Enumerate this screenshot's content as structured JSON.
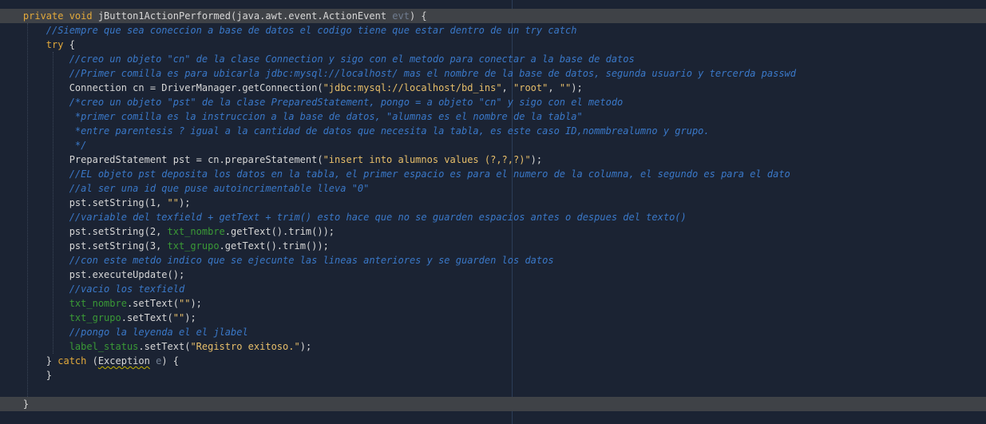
{
  "theme": {
    "background": "#1b2333",
    "keyword": "#e2a93b",
    "comment": "#3a78c8",
    "string": "#e8bf6a",
    "field": "#3a9a36",
    "parameter": "#6f7c90",
    "plain": "#d7d7d7",
    "current_line": "#3f4247"
  },
  "lines": [
    {
      "hl": true,
      "tokens": [
        {
          "t": "    "
        },
        {
          "t": "private void ",
          "c": "kw"
        },
        {
          "t": "jButton1ActionPerformed(java.awt.event.ActionEvent "
        },
        {
          "t": "evt",
          "c": "par"
        },
        {
          "t": ") {"
        }
      ]
    },
    {
      "tokens": [
        {
          "t": "        "
        },
        {
          "t": "//Siempre que sea coneccion a base de datos el codigo tiene que estar dentro de un try catch",
          "c": "cm"
        }
      ]
    },
    {
      "tokens": [
        {
          "t": "        "
        },
        {
          "t": "try",
          "c": "kw"
        },
        {
          "t": " {"
        }
      ]
    },
    {
      "tokens": [
        {
          "t": "            "
        },
        {
          "t": "//creo un objeto \"cn\" de la clase Connection y sigo con el metodo para conectar a la base de datos",
          "c": "cm"
        }
      ]
    },
    {
      "tokens": [
        {
          "t": "            "
        },
        {
          "t": "//Primer comilla es para ubicarla jdbc:mysql://localhost/ mas el nombre de la base de datos, segunda usuario y tercerda passwd",
          "c": "cm"
        }
      ]
    },
    {
      "tokens": [
        {
          "t": "            Connection cn = DriverManager.getConnection("
        },
        {
          "t": "\"jdbc:mysql://localhost/bd_ins\"",
          "c": "st"
        },
        {
          "t": ", "
        },
        {
          "t": "\"root\"",
          "c": "st"
        },
        {
          "t": ", "
        },
        {
          "t": "\"\"",
          "c": "st"
        },
        {
          "t": ");"
        }
      ]
    },
    {
      "tokens": [
        {
          "t": "            "
        },
        {
          "t": "/*creo un objeto \"pst\" de la clase PreparedStatement, pongo = a objeto \"cn\" y sigo con el metodo",
          "c": "cm"
        }
      ]
    },
    {
      "tokens": [
        {
          "t": "             "
        },
        {
          "t": "*primer comilla es la instruccion a la base de datos, \"alumnas es el nombre de la tabla\"",
          "c": "cm"
        }
      ]
    },
    {
      "tokens": [
        {
          "t": "             "
        },
        {
          "t": "*entre parentesis ? igual a la cantidad de datos que necesita la tabla, es este caso ID,nommbrealumno y grupo.",
          "c": "cm"
        }
      ]
    },
    {
      "tokens": [
        {
          "t": "             "
        },
        {
          "t": "*/",
          "c": "cm"
        }
      ]
    },
    {
      "tokens": [
        {
          "t": "            PreparedStatement pst = cn.prepareStatement("
        },
        {
          "t": "\"insert into alumnos values (?,?,?)\"",
          "c": "st"
        },
        {
          "t": ");"
        }
      ]
    },
    {
      "tokens": [
        {
          "t": "            "
        },
        {
          "t": "//EL objeto pst deposita los datos en la tabla, el primer espacio es para el numero de la columna, el segundo es para el dato",
          "c": "cm"
        }
      ]
    },
    {
      "tokens": [
        {
          "t": "            "
        },
        {
          "t": "//al ser una id que puse autoincrimentable lleva \"0\"",
          "c": "cm"
        }
      ]
    },
    {
      "tokens": [
        {
          "t": "            pst.setString(1, "
        },
        {
          "t": "\"\"",
          "c": "st"
        },
        {
          "t": ");"
        }
      ]
    },
    {
      "tokens": [
        {
          "t": "            "
        },
        {
          "t": "//variable del texfield + getText + trim() esto hace que no se guarden espacios antes o despues del texto()",
          "c": "cm"
        }
      ]
    },
    {
      "tokens": [
        {
          "t": "            pst.setString(2, "
        },
        {
          "t": "txt_nombre",
          "c": "fld"
        },
        {
          "t": ".getText().trim());"
        }
      ]
    },
    {
      "tokens": [
        {
          "t": "            pst.setString(3, "
        },
        {
          "t": "txt_grupo",
          "c": "fld"
        },
        {
          "t": ".getText().trim());"
        }
      ]
    },
    {
      "tokens": [
        {
          "t": "            "
        },
        {
          "t": "//con este metdo indico que se ejecunte las lineas anteriores y se guarden los datos",
          "c": "cm"
        }
      ]
    },
    {
      "tokens": [
        {
          "t": "            pst.executeUpdate();"
        }
      ]
    },
    {
      "tokens": [
        {
          "t": "            "
        },
        {
          "t": "//vacio los texfield",
          "c": "cm"
        }
      ]
    },
    {
      "tokens": [
        {
          "t": "            "
        },
        {
          "t": "txt_nombre",
          "c": "fld"
        },
        {
          "t": ".setText("
        },
        {
          "t": "\"\"",
          "c": "st"
        },
        {
          "t": ");"
        }
      ]
    },
    {
      "tokens": [
        {
          "t": "            "
        },
        {
          "t": "txt_grupo",
          "c": "fld"
        },
        {
          "t": ".setText("
        },
        {
          "t": "\"\"",
          "c": "st"
        },
        {
          "t": ");"
        }
      ]
    },
    {
      "tokens": [
        {
          "t": "            "
        },
        {
          "t": "//pongo la leyenda el el jlabel",
          "c": "cm"
        }
      ]
    },
    {
      "tokens": [
        {
          "t": "            "
        },
        {
          "t": "label_status",
          "c": "fld"
        },
        {
          "t": ".setText("
        },
        {
          "t": "\"Registro exitoso.\"",
          "c": "st"
        },
        {
          "t": ");"
        }
      ]
    },
    {
      "tokens": [
        {
          "t": "        } "
        },
        {
          "t": "catch",
          "c": "kw"
        },
        {
          "t": " ("
        },
        {
          "t": "Exception",
          "c": "ul"
        },
        {
          "t": " "
        },
        {
          "t": "e",
          "c": "par"
        },
        {
          "t": ") {"
        }
      ]
    },
    {
      "tokens": [
        {
          "t": "        }"
        }
      ]
    },
    {
      "tokens": [
        {
          "t": ""
        }
      ]
    },
    {
      "hl": true,
      "tokens": [
        {
          "t": "    }"
        }
      ]
    }
  ]
}
